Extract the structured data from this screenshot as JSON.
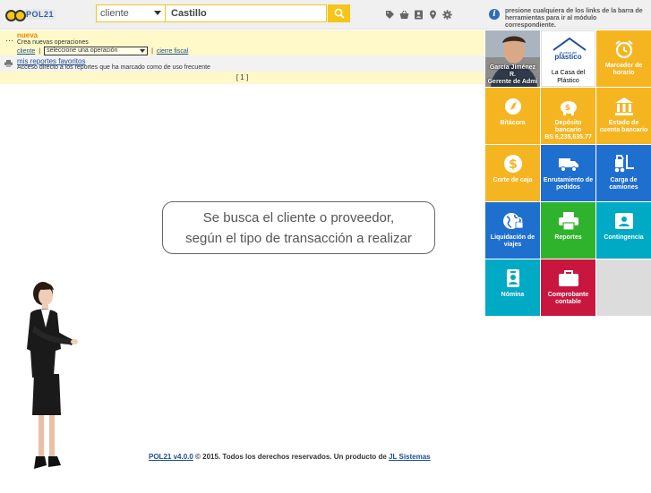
{
  "header": {
    "brand": "POL21",
    "search_type": "cliente",
    "search_value": "Castillo",
    "info_text": "presione cualquiera de los links de la barra de herramientas para ir al módulo correspondiente."
  },
  "operations": {
    "title": "nueva",
    "description": "Crea nuevas operaciones",
    "client_link": "cliente",
    "sep1": "|",
    "select_value": "seleccione una operación",
    "sep2": "|",
    "close_link": "cierre fiscal"
  },
  "favorites": {
    "title": "mis reportes favoritos",
    "description": "Acceso directo a los reportes que ha marcado como de uso frecuente"
  },
  "pager": {
    "text": "[ 1 ]"
  },
  "callout": {
    "line1": "Se busca el cliente o proveedor,",
    "line2": "según el tipo de transacción a realizar"
  },
  "footer": {
    "version_link": "POL21 v4.0.0",
    "text": " © 2015. Todos los derechos reservados. Un producto de ",
    "company_link": "JL Sistemas"
  },
  "tiles": {
    "user": {
      "name": "García Jiménez R.",
      "role": "Gerente de Admi"
    },
    "client": {
      "logo_top": "la casa del",
      "logo_main": "plástico",
      "name": "La Casa del Plástico"
    },
    "horario": "Marcador de horario",
    "bitacora": "Bitácora",
    "deposito": "Depósito bancario",
    "deposito_amount": "BS 6,235,635.77",
    "estado": "Estado de cuenta bancario",
    "corte": "Corte de caja",
    "enrutamiento": "Enrutamiento de pedidos",
    "carga": "Carga de camiones",
    "liquidacion": "Liquidación de viajes",
    "reportes": "Reportes",
    "contingencia": "Contingencia",
    "nomina": "Nómina",
    "comprobante": "Comprobante contable"
  },
  "colors": {
    "accent_yellow": "#f5b521",
    "blue": "#1f6fcf",
    "green": "#2fb32c",
    "teal": "#00a9c4",
    "red": "#c9163f"
  }
}
